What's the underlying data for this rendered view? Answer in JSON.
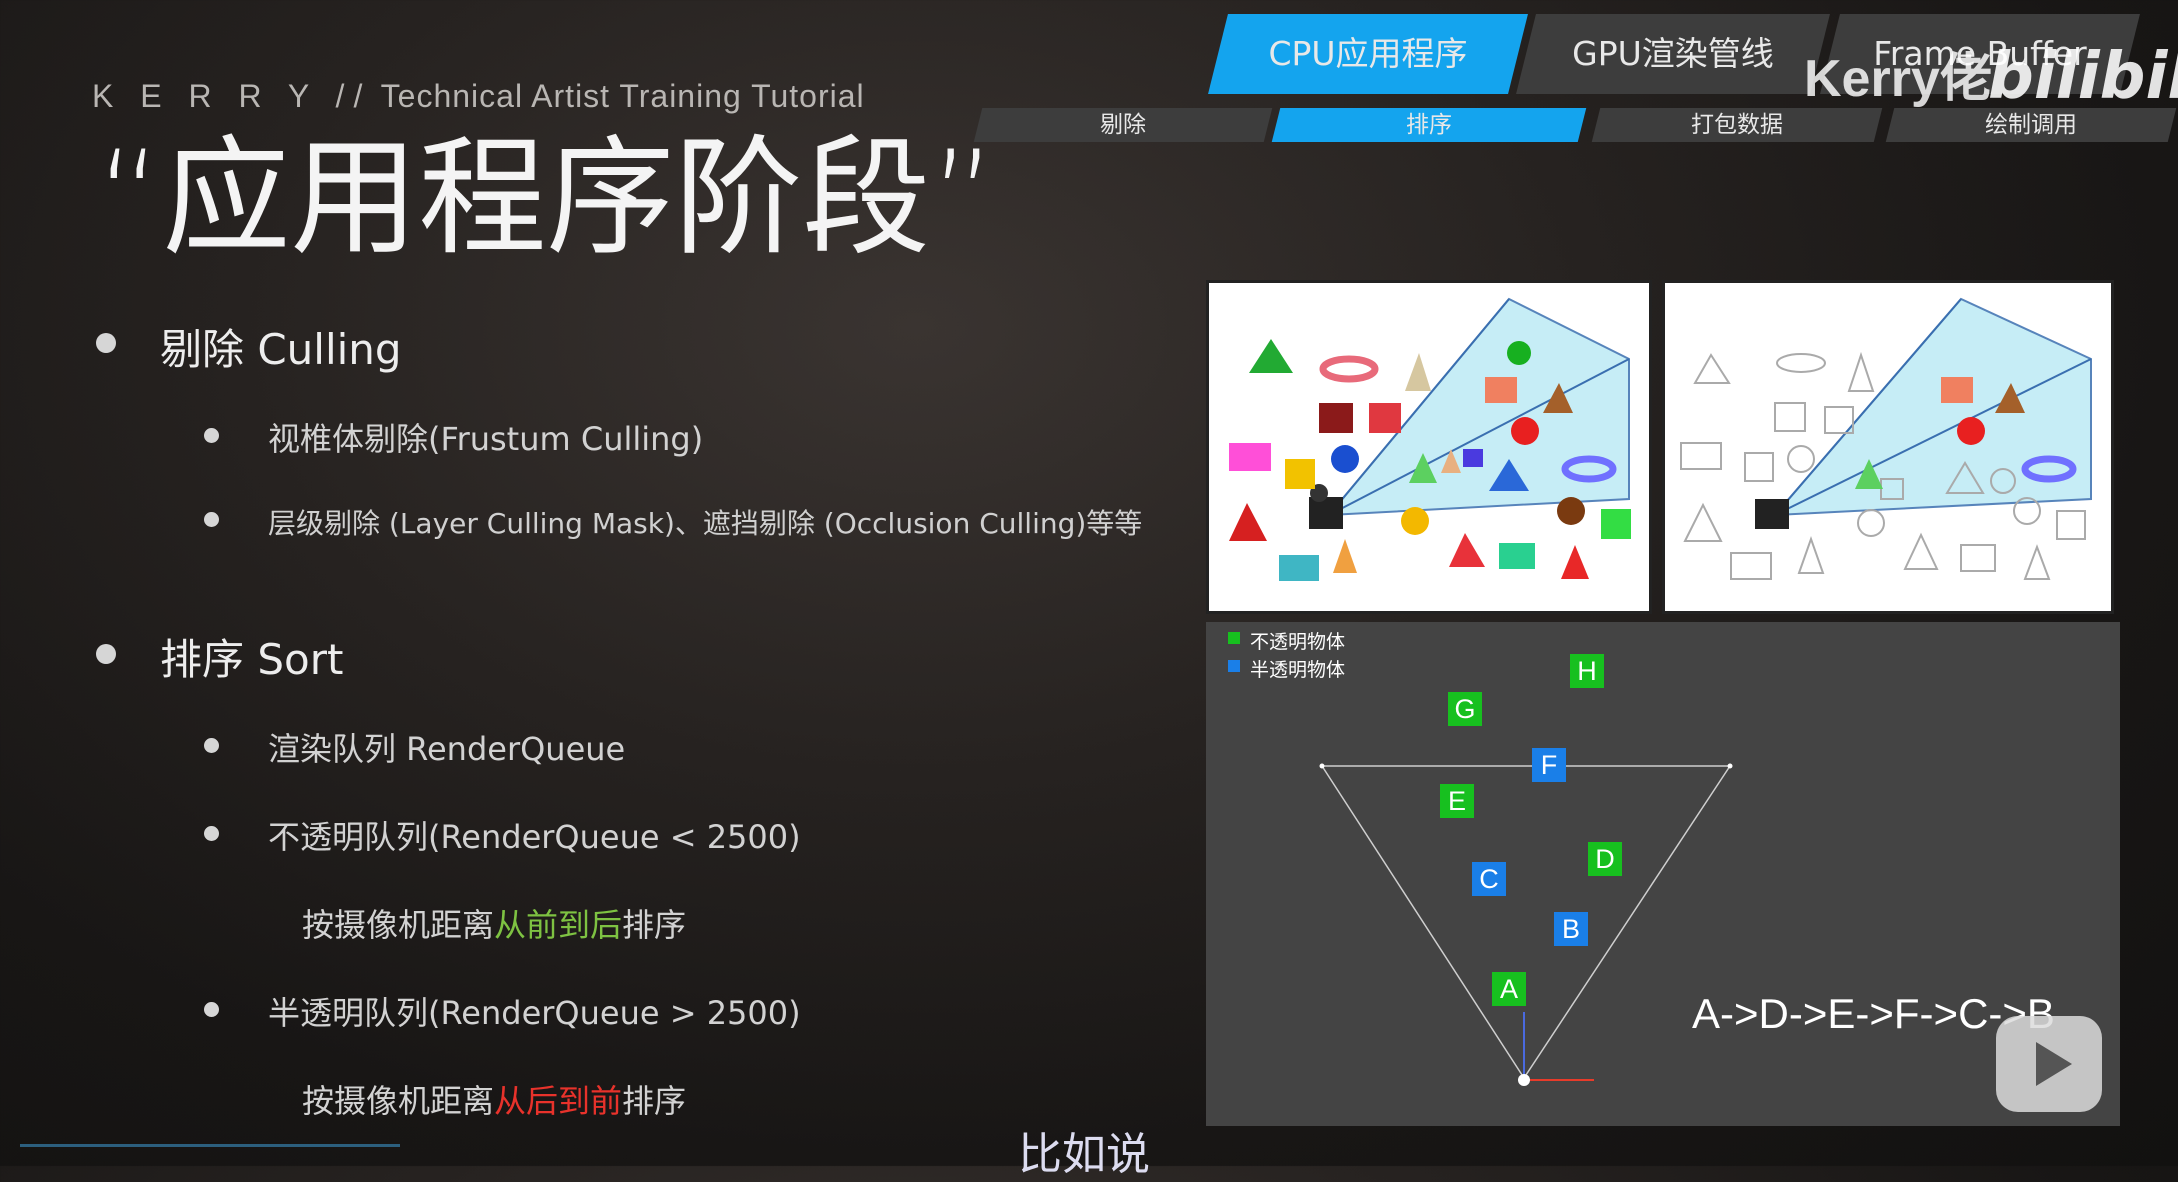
{
  "header": {
    "brand": "K E R R Y //",
    "subtitle": "Technical Artist Training Tutorial",
    "title": "“应用程序阶段”"
  },
  "tabs": [
    {
      "label": "CPU应用程序",
      "active": true
    },
    {
      "label": "GPU渲染管线",
      "active": false
    },
    {
      "label": "Frame Buffer",
      "active": false
    }
  ],
  "subtabs": [
    {
      "label": "剔除",
      "active": false
    },
    {
      "label": "排序",
      "active": true
    },
    {
      "label": "打包数据",
      "active": false
    },
    {
      "label": "绘制调用",
      "active": false
    }
  ],
  "watermark": {
    "author": "Kerry佬",
    "site": "bilibili"
  },
  "content": {
    "culling": {
      "heading": "剔除 Culling",
      "item1": "视椎体剔除(Frustum Culling)",
      "item2": "层级剔除 (Layer Culling Mask)、遮挡剔除 (Occlusion Culling)等等"
    },
    "sort": {
      "heading": "排序 Sort",
      "item1": "渲染队列 RenderQueue",
      "item2": "不透明队列(RenderQueue < 2500)",
      "item2_sub_pre": "按摄像机距离",
      "item2_sub_hl": "从前到后",
      "item2_sub_post": "排序",
      "item3": "半透明队列(RenderQueue > 2500)",
      "item3_sub_pre": "按摄像机距离",
      "item3_sub_hl": "从后到前",
      "item3_sub_post": "排序"
    }
  },
  "diagram": {
    "legend_opaque": "不透明物体",
    "legend_transparent": "半透明物体",
    "labels": {
      "A": "A",
      "B": "B",
      "C": "C",
      "D": "D",
      "E": "E",
      "F": "F",
      "G": "G",
      "H": "H"
    },
    "sequence": "A->D->E->F->C->B"
  },
  "caption": "比如说",
  "colors": {
    "accent_blue": "#14a4ee",
    "tab_gray": "#3d3d3d",
    "highlight_green": "#7ec242",
    "highlight_red": "#e8322b",
    "opaque_green": "#17c01f",
    "transparent_blue": "#1a7fe8"
  }
}
